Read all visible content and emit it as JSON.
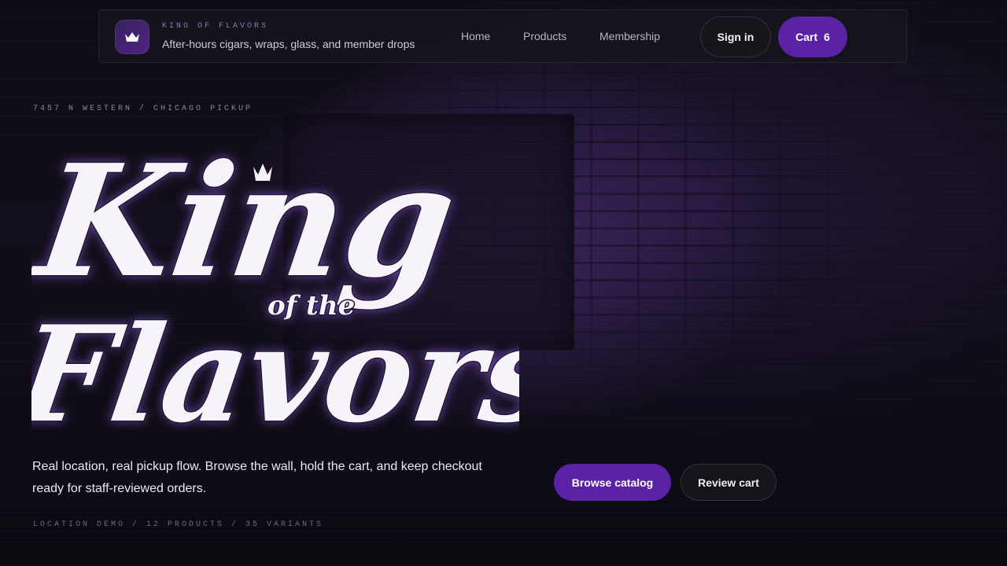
{
  "nav": {
    "brand_title": "KING OF FLAVORS",
    "brand_subtitle": "After-hours cigars, wraps, glass, and member drops",
    "links": [
      "Home",
      "Products",
      "Membership"
    ],
    "sign_in_label": "Sign in",
    "cart_label": "Cart",
    "cart_count": "6"
  },
  "hero": {
    "eyebrow": "7457 N WESTERN / CHICAGO PICKUP",
    "logo_text": {
      "line1": "King",
      "middle": "of the",
      "line2": "Flavors"
    },
    "tagline": "Real location, real pickup flow. Browse the wall, hold the cart, and keep checkout ready for staff-reviewed orders.",
    "meta": "LOCATION DEMO / 12 PRODUCTS / 35 VARIANTS",
    "browse_label": "Browse catalog",
    "review_label": "Review cart"
  },
  "colors": {
    "accent": "#5b22a6",
    "background": "#0c0a12",
    "brand_title": "#9078c0"
  },
  "icons": {
    "logo": "crown-icon",
    "hero_crown": "crown-icon"
  }
}
